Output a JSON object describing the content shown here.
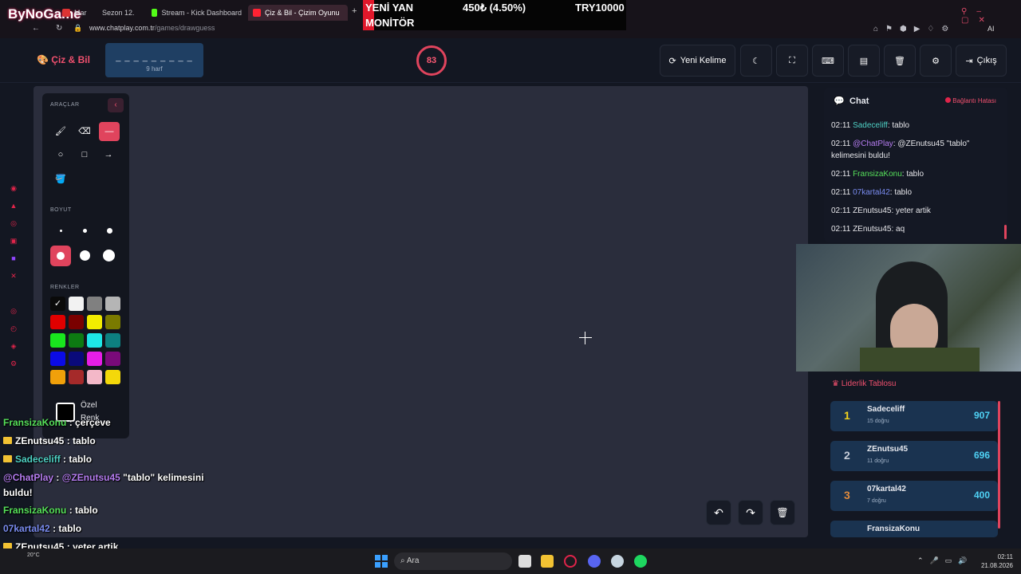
{
  "browser": {
    "logo": "ByNoGame",
    "tabs": [
      {
        "label": "Mar"
      },
      {
        "label": "Sezon 12."
      },
      {
        "label": "Stream - Kick Dashboard"
      },
      {
        "label": "Çiz & Bil - Çizim Oyunu"
      }
    ],
    "address_prefix": "www.chatplay.com.tr",
    "address_path": "/games/drawguess",
    "ai_label": "AI"
  },
  "ad": {
    "line1": "YENİ YAN",
    "line2": "MONİTÖR",
    "price_change": "450₺ (4.50%)",
    "price": "TRY10000"
  },
  "app": {
    "title": "Çiz & Bil",
    "word_placeholder": "_ _ _ _ _ _ _ _ _",
    "word_hint": "9 harf",
    "timer": "83",
    "new_word_label": "Yeni Kelime",
    "logout_label": "Çıkış"
  },
  "tools": {
    "sections": {
      "tools": "ARAÇLAR",
      "size": "BOYUT",
      "colors": "RENKLER"
    },
    "custom_color_line1": "Özel",
    "custom_color_line2": "Renk",
    "colors": [
      "#0a0a0a",
      "#f2f2f2",
      "#808080",
      "#b5b5b5",
      "#e00000",
      "#7a0000",
      "#f2ec00",
      "#7a7a00",
      "#19e61e",
      "#0d7a12",
      "#1ee6e6",
      "#0d8080",
      "#0b0be6",
      "#0a0a7a",
      "#e61ee6",
      "#7a0a7a",
      "#f0a00a",
      "#a52a2a",
      "#f4b8c8",
      "#f4d80a"
    ]
  },
  "chat": {
    "title": "Chat",
    "status": "Bağlantı Hatası",
    "messages": [
      {
        "time": "02:11",
        "user": "Sadeceliff",
        "user_color": "#4fd1c5",
        "text": ": tablo"
      },
      {
        "time": "02:11",
        "user": "@ChatPlay",
        "user_color": "#b57cf0",
        "text": ": @ZEnutsu45 \"tablo\"",
        "text2": "kelimesini buldu!"
      },
      {
        "time": "02:11",
        "user": "FransizaKonu",
        "user_color": "#56e05a",
        "text": ": tablo"
      },
      {
        "time": "02:11",
        "user": "07kartal42",
        "user_color": "#7a8cf0",
        "text": ": tablo"
      },
      {
        "time": "02:11",
        "user": "ZEnutsu45",
        "user_color": "#e6e6ea",
        "text": ": yeter artik"
      },
      {
        "time": "02:11",
        "user": "ZEnutsu45",
        "user_color": "#e6e6ea",
        "text": ": aq"
      }
    ]
  },
  "leaderboard": {
    "title": "Liderlik Tablosu",
    "rows": [
      {
        "rank": "1",
        "name": "Sadeceliff",
        "sub": "15 doğru",
        "score": "907",
        "rank_color": "#f2d21b"
      },
      {
        "rank": "2",
        "name": "ZEnutsu45",
        "sub": "11 doğru",
        "score": "696",
        "rank_color": "#c7cdd8"
      },
      {
        "rank": "3",
        "name": "07kartal42",
        "sub": "7 doğru",
        "score": "400",
        "rank_color": "#e08a3c"
      }
    ],
    "partial_row": "FransizaKonu"
  },
  "overlay_chat": [
    {
      "user": "FransizaKonu",
      "color": "#56e05a",
      "text": ": çerçeve",
      "badge": false
    },
    {
      "user": "ZEnutsu45",
      "color": "#ffffff",
      "text": ": tablo",
      "badge": true
    },
    {
      "user": "Sadeceliff",
      "color": "#4fd1c5",
      "text": ": tablo",
      "badge": true
    },
    {
      "user": "@ChatPlay",
      "color": "#b57cf0",
      "text": ": ",
      "mention": "@ZEnutsu45",
      "text2": " \"tablo\" kelimesini",
      "badge": false
    },
    {
      "user": "",
      "color": "#ffffff",
      "text": "buldu!",
      "badge": false
    },
    {
      "user": "FransizaKonu",
      "color": "#56e05a",
      "text": ": tablo",
      "badge": false
    },
    {
      "user": "07kartal42",
      "color": "#7a8cf0",
      "text": ": tablo",
      "badge": false
    },
    {
      "user": "ZEnutsu45",
      "color": "#ffffff",
      "text": ": yeter artik",
      "badge": true
    },
    {
      "user": "ZEnutsu45",
      "color": "#ffffff",
      "text": ": aq",
      "badge": true
    }
  ],
  "taskbar": {
    "search": "Ara",
    "weather": "20°C",
    "time": "02:11",
    "date": "21.08.2026"
  }
}
